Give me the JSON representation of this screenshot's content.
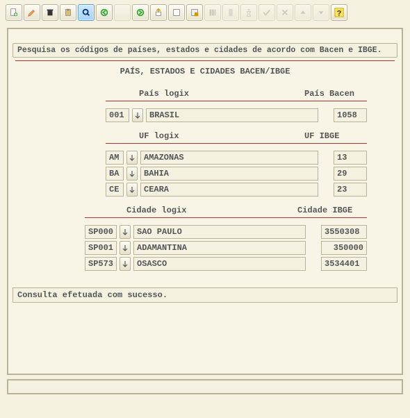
{
  "toolbar_icons": [
    "new",
    "edit",
    "delete",
    "paste",
    "search",
    "first",
    "prev",
    "next",
    "last",
    "output",
    "columns",
    "report",
    "report2",
    "run",
    "ok",
    "cancel",
    "up",
    "down",
    "help"
  ],
  "description": "Pesquisa os códigos de países, estados e cidades de acordo com Bacen e IBGE.",
  "title": "PAÍS, ESTADOS E CIDADES BACEN/IBGE",
  "pais": {
    "label_logix": "País logix",
    "label_bacen": "País Bacen",
    "code": "001",
    "name": "BRASIL",
    "bacen": "1058"
  },
  "uf": {
    "label_logix": "UF logix",
    "label_ibge": "UF IBGE",
    "rows": [
      {
        "code": "AM",
        "name": "AMAZONAS",
        "ibge": "13"
      },
      {
        "code": "BA",
        "name": "BAHIA",
        "ibge": "29"
      },
      {
        "code": "CE",
        "name": "CEARA",
        "ibge": "23"
      }
    ]
  },
  "cidade": {
    "label_logix": "Cidade logix",
    "label_ibge": "Cidade IBGE",
    "rows": [
      {
        "code": "SP000",
        "name": "SAO PAULO",
        "ibge": "3550308"
      },
      {
        "code": "SP001",
        "name": "ADAMANTINA",
        "ibge": "350000"
      },
      {
        "code": "SP573",
        "name": "OSASCO",
        "ibge": "3534401"
      }
    ]
  },
  "status": "Consulta efetuada com sucesso."
}
